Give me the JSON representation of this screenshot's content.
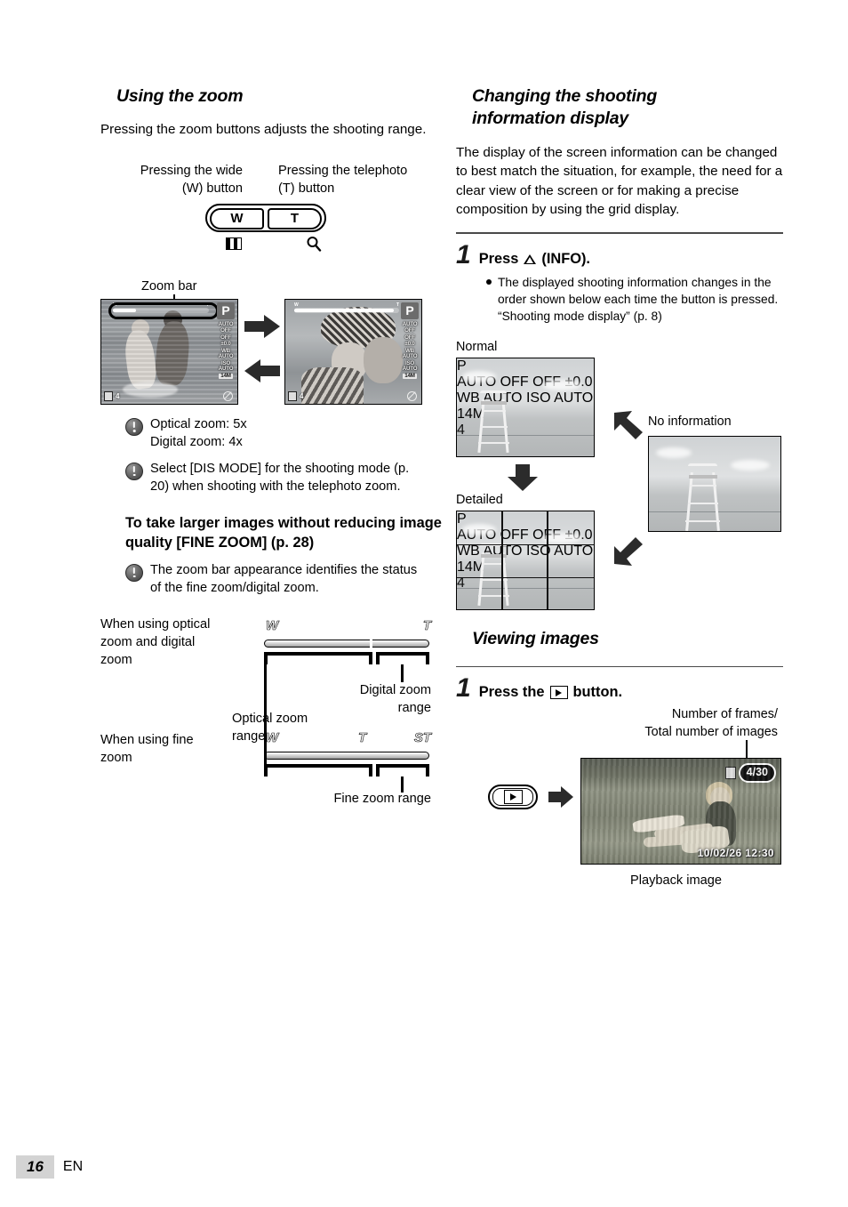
{
  "left": {
    "section_title": "Using the zoom",
    "intro": "Pressing the zoom buttons adjusts the shooting range.",
    "wide_caption": "Pressing the wide (W) button",
    "wide_caption_l1": "Pressing the wide",
    "wide_caption_l2": "(W) button",
    "tele_caption_l1": "Pressing the telephoto",
    "tele_caption_l2": "(T) button",
    "w_button_label": "W",
    "t_button_label": "T",
    "w_icon_name": "thumbnail-index-icon",
    "t_icon_name": "magnifier-icon",
    "zoom_bar_label": "Zoom bar",
    "lcd": {
      "mode": "P",
      "side_icons": [
        "AUTO",
        "OFF",
        "OFF",
        "±0.0",
        "WB AUTO",
        "ISO AUTO",
        "14M"
      ],
      "flash": "AUTO",
      "macro": "OFF",
      "timer": "OFF",
      "exposure": "±0.0",
      "wb": "WB AUTO",
      "iso": "ISO AUTO",
      "size": "14M",
      "frames": "4",
      "bar_w": "W",
      "bar_t": "T"
    },
    "notes": [
      "Optical zoom: 5x\nDigital zoom: 4x",
      "Select [DIS MODE] for the shooting mode (p. 20) when shooting with the telephoto zoom."
    ],
    "note_1_line1": "Optical zoom: 5x",
    "note_1_line2": "Digital zoom: 4x",
    "note_2": "Select [DIS MODE] for the shooting mode (p. 20) when shooting with the telephoto zoom.",
    "subhead": "To take larger images without reducing image quality [FINE ZOOM] (p. 28)",
    "note_3": "The zoom bar appearance identifies the status of the fine zoom/digital zoom.",
    "range1_label": "When using optical zoom and digital zoom",
    "range1_tick_w": "W",
    "range1_tick_t": "T",
    "range1_cap_left_l1": "Optical zoom",
    "range1_cap_left_l2": "range",
    "range1_cap_right_l1": "Digital zoom",
    "range1_cap_right_l2": "range",
    "range2_label": "When using fine zoom",
    "range2_tick_w": "W",
    "range2_tick_t": "T",
    "range2_tick_st": "ST",
    "range2_cap": "Fine zoom range"
  },
  "right": {
    "section_title_l1": "Changing the shooting",
    "section_title_l2": "information display",
    "intro": "The display of the screen information can be changed to best match the situation, for example, the need for a clear view of the screen or for making a precise composition by using the grid display.",
    "step1_num": "1",
    "step1_title_pre": "Press",
    "step1_title_post": "(INFO).",
    "step1_icon_name": "up-arrow-info-icon",
    "step1_bullet": "The displayed shooting information changes in the order shown below each time the button is pressed. “Shooting mode display” (p. 8)",
    "label_normal": "Normal",
    "label_detailed": "Detailed",
    "label_no_info": "No information",
    "lcd_mode": "P",
    "viewing_title": "Viewing images",
    "step2_num": "1",
    "step2_title_pre": "Press the",
    "step2_title_post": "button.",
    "step2_icon_name": "playback-button-icon",
    "frames_caption_l1": "Number of frames/",
    "frames_caption_l2": "Total number of images",
    "frame_counter": "4/30",
    "timestamp": "10/02/26  12:30",
    "playback_caption": "Playback image"
  },
  "footer": {
    "page_number": "16",
    "language": "EN"
  },
  "colors": {
    "header_bar": "#d3d3d3",
    "rule": "#4a4a4a",
    "text": "#000000"
  }
}
